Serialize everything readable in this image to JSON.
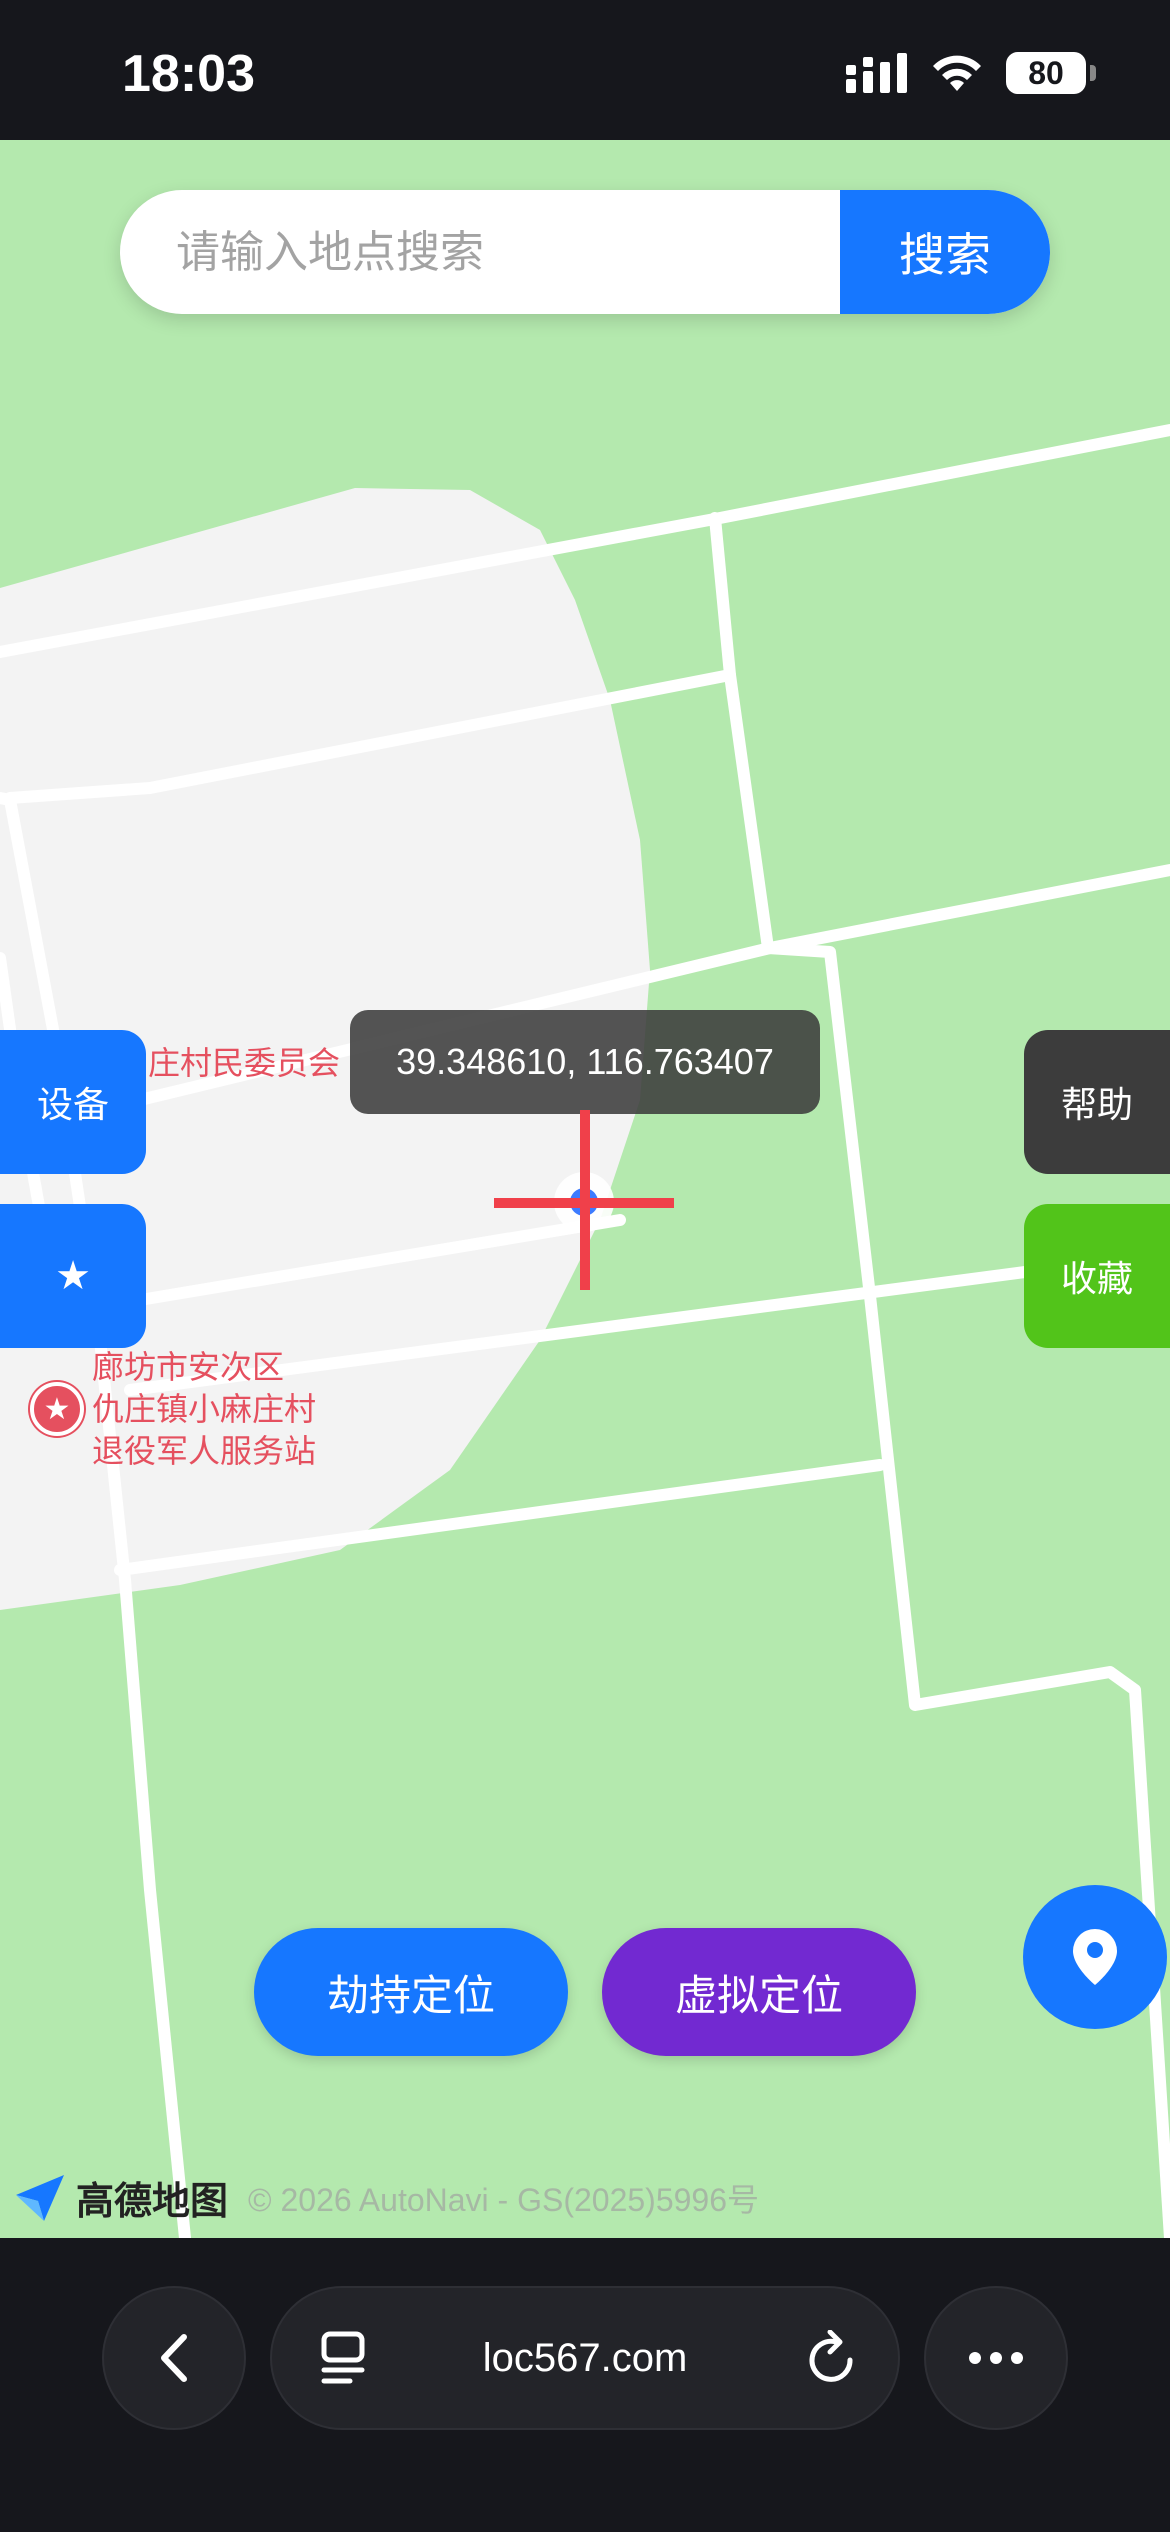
{
  "status_bar": {
    "time": "18:03",
    "battery": "80"
  },
  "search": {
    "placeholder": "请输入地点搜索",
    "button_label": "搜索"
  },
  "poi": {
    "committee": "庄村民委员会",
    "station_line1": "廊坊市安次区",
    "station_line2": "仇庄镇小麻庄村",
    "station_line3": "退役军人服务站"
  },
  "coordinates": "39.348610, 116.763407",
  "side_buttons": {
    "device": "设备",
    "star": "★",
    "help": "帮助",
    "favorite": "收藏"
  },
  "actions": {
    "hijack": "劫持定位",
    "virtual": "虚拟定位"
  },
  "footer": {
    "brand": "高德地图",
    "copyright": "© 2026 AutoNavi - GS(2025)5996号"
  },
  "browser": {
    "url": "loc567.com"
  },
  "colors": {
    "primary": "#1677ff",
    "purple": "#7229d1",
    "green": "#52c41a",
    "dark_gray": "#3c3c3c",
    "poi_red": "#e5505f",
    "map_green": "#b4e9ae"
  },
  "icons": [
    "signal-icon",
    "wifi-icon",
    "battery-icon",
    "location-pin-icon",
    "back-icon",
    "tabs-icon",
    "reload-icon",
    "more-icon"
  ]
}
